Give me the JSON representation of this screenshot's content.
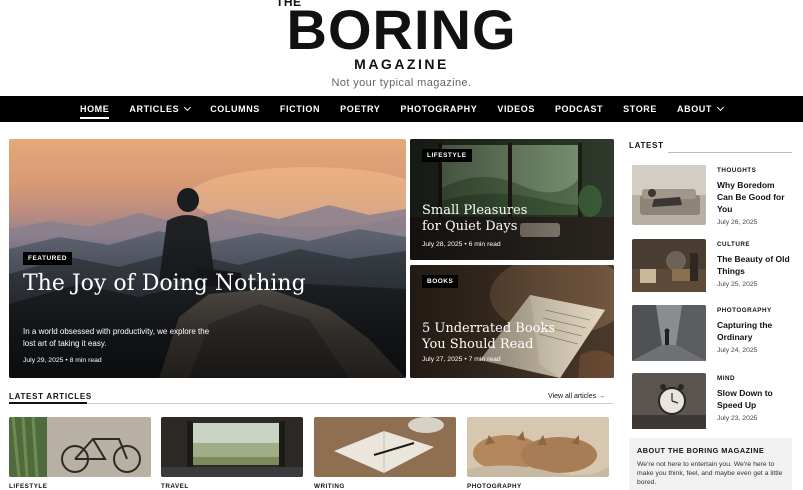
{
  "masthead": {
    "the": "THE",
    "title": "BORING",
    "subtitle": "MAGAZINE",
    "tagline": "Not your typical magazine."
  },
  "nav": {
    "items": [
      {
        "label": "HOME",
        "active": true,
        "dropdown": false
      },
      {
        "label": "ARTICLES",
        "active": false,
        "dropdown": true
      },
      {
        "label": "COLUMNS",
        "active": false,
        "dropdown": false
      },
      {
        "label": "FICTION",
        "active": false,
        "dropdown": false
      },
      {
        "label": "POETRY",
        "active": false,
        "dropdown": false
      },
      {
        "label": "PHOTOGRAPHY",
        "active": false,
        "dropdown": false
      },
      {
        "label": "VIDEOS",
        "active": false,
        "dropdown": false
      },
      {
        "label": "PODCAST",
        "active": false,
        "dropdown": false
      },
      {
        "label": "STORE",
        "active": false,
        "dropdown": false
      },
      {
        "label": "ABOUT",
        "active": false,
        "dropdown": true
      }
    ]
  },
  "hero": {
    "badge": "FEATURED",
    "title": "The Joy of Doing Nothing",
    "description": "In a world obsessed with productivity, we explore the lost art of taking it easy.",
    "date": "July 29, 2025",
    "read_time": "8 min read",
    "meta": "July 29, 2025  •  8 min read"
  },
  "cards": [
    {
      "badge": "LIFESTYLE",
      "title": "Small Pleasures for Quiet Days",
      "meta": "July 28, 2025  •  6 min read"
    },
    {
      "badge": "BOOKS",
      "title": "5 Underrated Books You Should Read",
      "meta": "July 27, 2025  •  7 min read"
    }
  ],
  "latest": {
    "heading": "LATEST",
    "items": [
      {
        "category": "THOUGHTS",
        "title": "Why Boredom Can Be Good for You",
        "date": "July 26, 2025"
      },
      {
        "category": "CULTURE",
        "title": "The Beauty of Old Things",
        "date": "July 25, 2025"
      },
      {
        "category": "PHOTOGRAPHY",
        "title": "Capturing the Ordinary",
        "date": "July 24, 2025"
      },
      {
        "category": "MIND",
        "title": "Slow Down to Speed Up",
        "date": "July 23, 2025"
      }
    ]
  },
  "about": {
    "title": "ABOUT THE BORING MAGAZINE",
    "text": "We're not here to entertain you. We're here to make you think, feel, and maybe even get a little bored."
  },
  "latest_articles": {
    "heading": "LATEST ARTICLES",
    "view_all": "View all articles →",
    "items": [
      {
        "category": "LIFESTYLE"
      },
      {
        "category": "TRAVEL"
      },
      {
        "category": "WRITING"
      },
      {
        "category": "PHOTOGRAPHY"
      }
    ]
  }
}
